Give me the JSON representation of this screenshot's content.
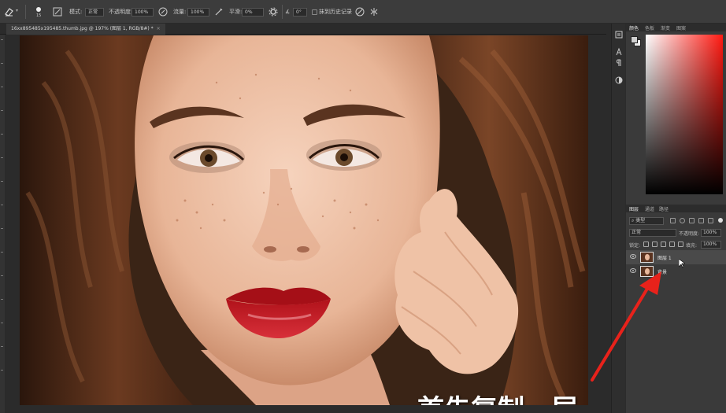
{
  "options_bar": {
    "brush_size": "15",
    "mode_label": "模式:",
    "mode_value": "正常",
    "opacity_label": "不透明度:",
    "opacity_value": "100%",
    "flow_label": "流量:",
    "flow_value": "100%",
    "smoothing_label": "平滑:",
    "smoothing_value": "0%",
    "angle_value": "0°",
    "erase_history_label": "抹到历史记录"
  },
  "document": {
    "tab_title": "16xx895485x195485.thumb.jpg @ 197% (图层 1, RGB/8#) *",
    "close_glyph": "×"
  },
  "tool_column": {
    "icons": [
      "history-icon",
      "character-icon",
      "paragraph-icon",
      "adjustment-icon"
    ]
  },
  "color_panel": {
    "tabs": [
      "颜色",
      "色板",
      "渐变",
      "图案"
    ],
    "active_tab": 0,
    "hue_color": "#ff1a12"
  },
  "layers_panel": {
    "tabs": [
      "图层",
      "通道",
      "路径"
    ],
    "active_tab": 0,
    "kind_filter": "类型",
    "blend_mode": "正常",
    "opacity_label": "不透明度:",
    "opacity_value": "100%",
    "lock_label": "锁定:",
    "fill_label": "填充:",
    "fill_value": "100%",
    "layers": [
      {
        "name": "图层 1",
        "selected": true,
        "visible": true
      },
      {
        "name": "背景",
        "selected": false,
        "visible": true
      }
    ]
  },
  "canvas": {
    "caption": "首先复制一层"
  },
  "annotation": {
    "arrow_color": "#e8221b"
  }
}
